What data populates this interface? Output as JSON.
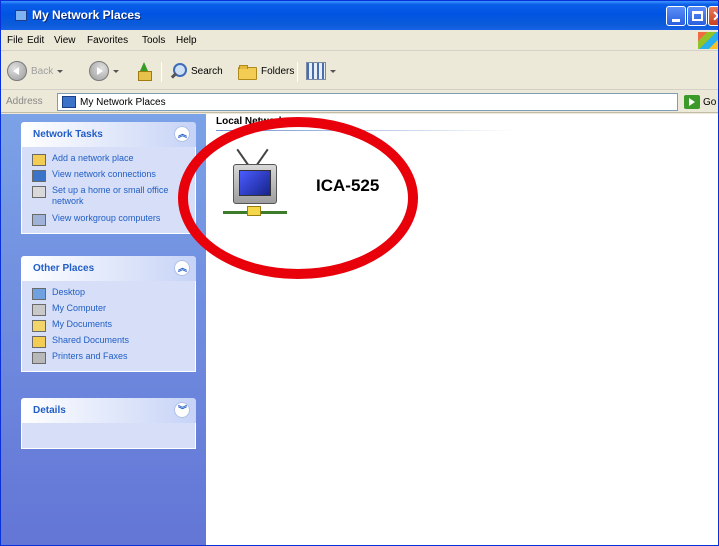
{
  "window": {
    "title": "My Network Places"
  },
  "menubar": {
    "items": [
      "File",
      "Edit",
      "View",
      "Favorites",
      "Tools",
      "Help"
    ]
  },
  "toolbar": {
    "back_label": "Back",
    "search_label": "Search",
    "folders_label": "Folders"
  },
  "addressbar": {
    "label": "Address",
    "value": "My Network Places",
    "go_label": "Go"
  },
  "taskpane": {
    "network_tasks": {
      "title": "Network Tasks",
      "items": [
        "Add a network place",
        "View network connections",
        "Set up a home or small office network",
        "View workgroup computers"
      ]
    },
    "other_places": {
      "title": "Other Places",
      "items": [
        "Desktop",
        "My Computer",
        "My Documents",
        "Shared Documents",
        "Printers and Faxes"
      ]
    },
    "details": {
      "title": "Details"
    }
  },
  "content": {
    "group_header": "Local Network",
    "computers": [
      {
        "name": "ICA-525"
      }
    ]
  },
  "colors": {
    "title_bar": "#0054e3",
    "task_pane": "#6f8fe0",
    "task_link": "#215dc6",
    "highlight": "#e8000b"
  }
}
